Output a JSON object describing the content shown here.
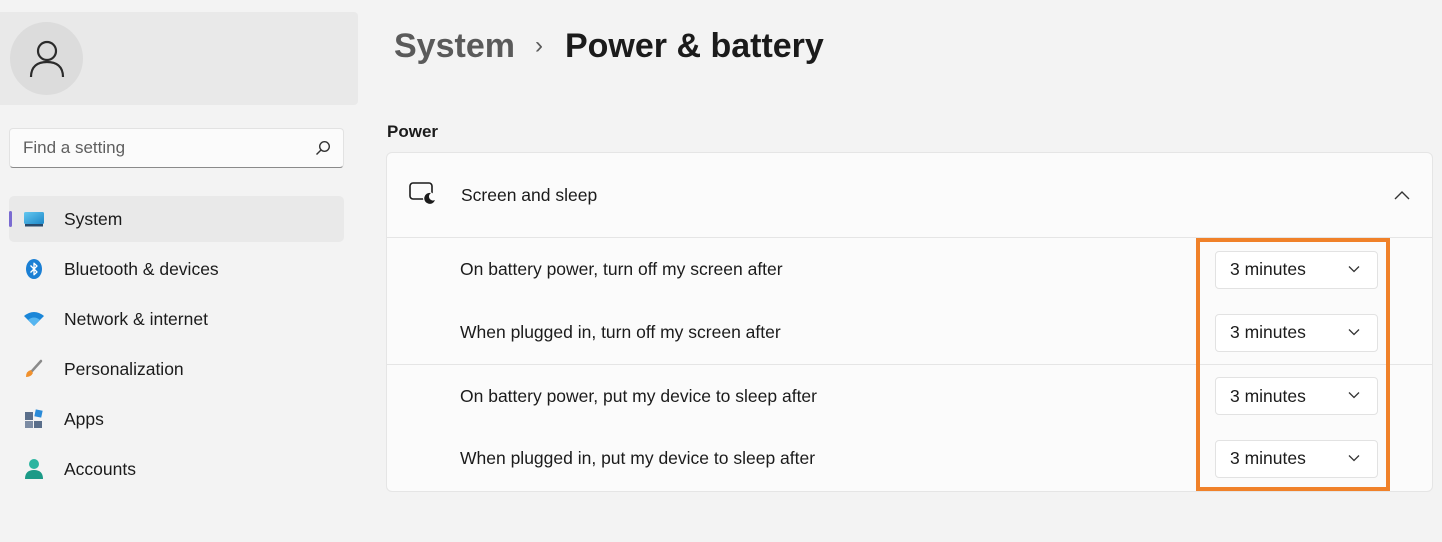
{
  "user": {
    "avatar_icon": "person-icon"
  },
  "search": {
    "placeholder": "Find a setting",
    "value": "",
    "icon": "search-icon"
  },
  "sidebar": {
    "items": [
      {
        "label": "System",
        "icon": "system-monitor-icon",
        "active": true
      },
      {
        "label": "Bluetooth & devices",
        "icon": "bluetooth-icon"
      },
      {
        "label": "Network & internet",
        "icon": "wifi-icon"
      },
      {
        "label": "Personalization",
        "icon": "paintbrush-icon"
      },
      {
        "label": "Apps",
        "icon": "apps-icon"
      },
      {
        "label": "Accounts",
        "icon": "account-icon"
      }
    ]
  },
  "header": {
    "parent": "System",
    "separator": "›",
    "current": "Power & battery"
  },
  "power": {
    "section_title": "Power",
    "screen_sleep": {
      "title": "Screen and sleep",
      "icon": "screen-sleep-icon",
      "expanded": true,
      "rows": [
        {
          "label": "On battery power, turn off my screen after",
          "value": "3 minutes"
        },
        {
          "label": "When plugged in, turn off my screen after",
          "value": "3 minutes"
        },
        {
          "label": "On battery power, put my device to sleep after",
          "value": "3 minutes"
        },
        {
          "label": "When plugged in, put my device to sleep after",
          "value": "3 minutes"
        }
      ]
    }
  },
  "colors": {
    "accent": "#7a6bd1",
    "highlight": "#f08129",
    "background": "#f3f3f3",
    "card": "#fbfbfb"
  }
}
